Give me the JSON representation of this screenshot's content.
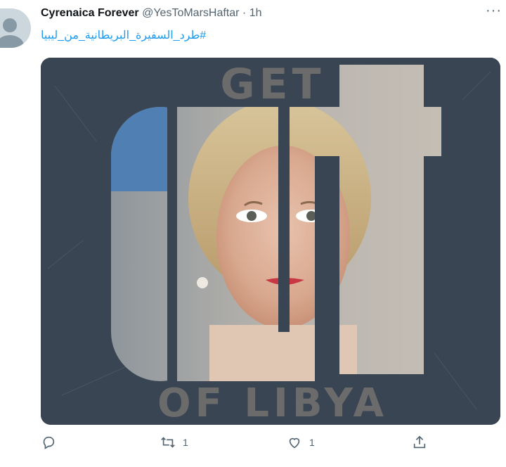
{
  "tweet": {
    "display_name": "Cyrenaica Forever",
    "handle": "@YesToMarsHaftar",
    "separator": "·",
    "time": "1h",
    "hashtag": "#طرد_السفيرة_البريطانية_من_ليبيا",
    "more_icon": "ellipsis-icon",
    "image": {
      "text_top": "GET",
      "text_mid": "out",
      "text_bottom": "OF LIBYA"
    }
  },
  "actions": {
    "reply": {
      "icon": "reply-icon",
      "count": ""
    },
    "retweet": {
      "icon": "retweet-icon",
      "count": "1"
    },
    "like": {
      "icon": "heart-icon",
      "count": "1"
    },
    "share": {
      "icon": "share-icon",
      "count": ""
    }
  },
  "colors": {
    "link": "#1d9bf0",
    "muted": "#536471",
    "poster_bg": "#3a4553",
    "poster_text": "#6b6b6b"
  }
}
